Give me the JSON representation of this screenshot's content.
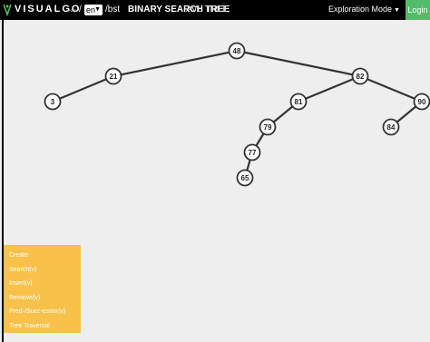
{
  "header": {
    "brand": "VISUALGO",
    "brand_suffix": ".NET",
    "slash": "/",
    "language": "en",
    "path": "/bst",
    "title_active": "BINARY SEARCH TREE",
    "title_inactive": "AVL TREE",
    "mode_label": "Exploration Mode",
    "login_label": "Login"
  },
  "tree": {
    "nodes": [
      {
        "id": "48",
        "label": "48"
      },
      {
        "id": "21",
        "label": "21"
      },
      {
        "id": "3",
        "label": "3"
      },
      {
        "id": "82",
        "label": "82"
      },
      {
        "id": "81",
        "label": "81"
      },
      {
        "id": "79",
        "label": "79"
      },
      {
        "id": "77",
        "label": "77"
      },
      {
        "id": "65",
        "label": "65"
      },
      {
        "id": "90",
        "label": "90"
      },
      {
        "id": "84",
        "label": "84"
      }
    ],
    "edges": [
      [
        "48",
        "21"
      ],
      [
        "21",
        "3"
      ],
      [
        "48",
        "82"
      ],
      [
        "82",
        "81"
      ],
      [
        "81",
        "79"
      ],
      [
        "79",
        "77"
      ],
      [
        "77",
        "65"
      ],
      [
        "82",
        "90"
      ],
      [
        "90",
        "84"
      ]
    ]
  },
  "menu": {
    "items": [
      "Create",
      "Search(v)",
      "Insert(v)",
      "Remove(v)",
      "Pred-/Succ-essor(v)",
      "Tree Traversal"
    ]
  },
  "colors": {
    "topbar": "#000000",
    "login": "#52bc69",
    "menu": "#f7c14a",
    "canvas": "#eeeeee"
  }
}
